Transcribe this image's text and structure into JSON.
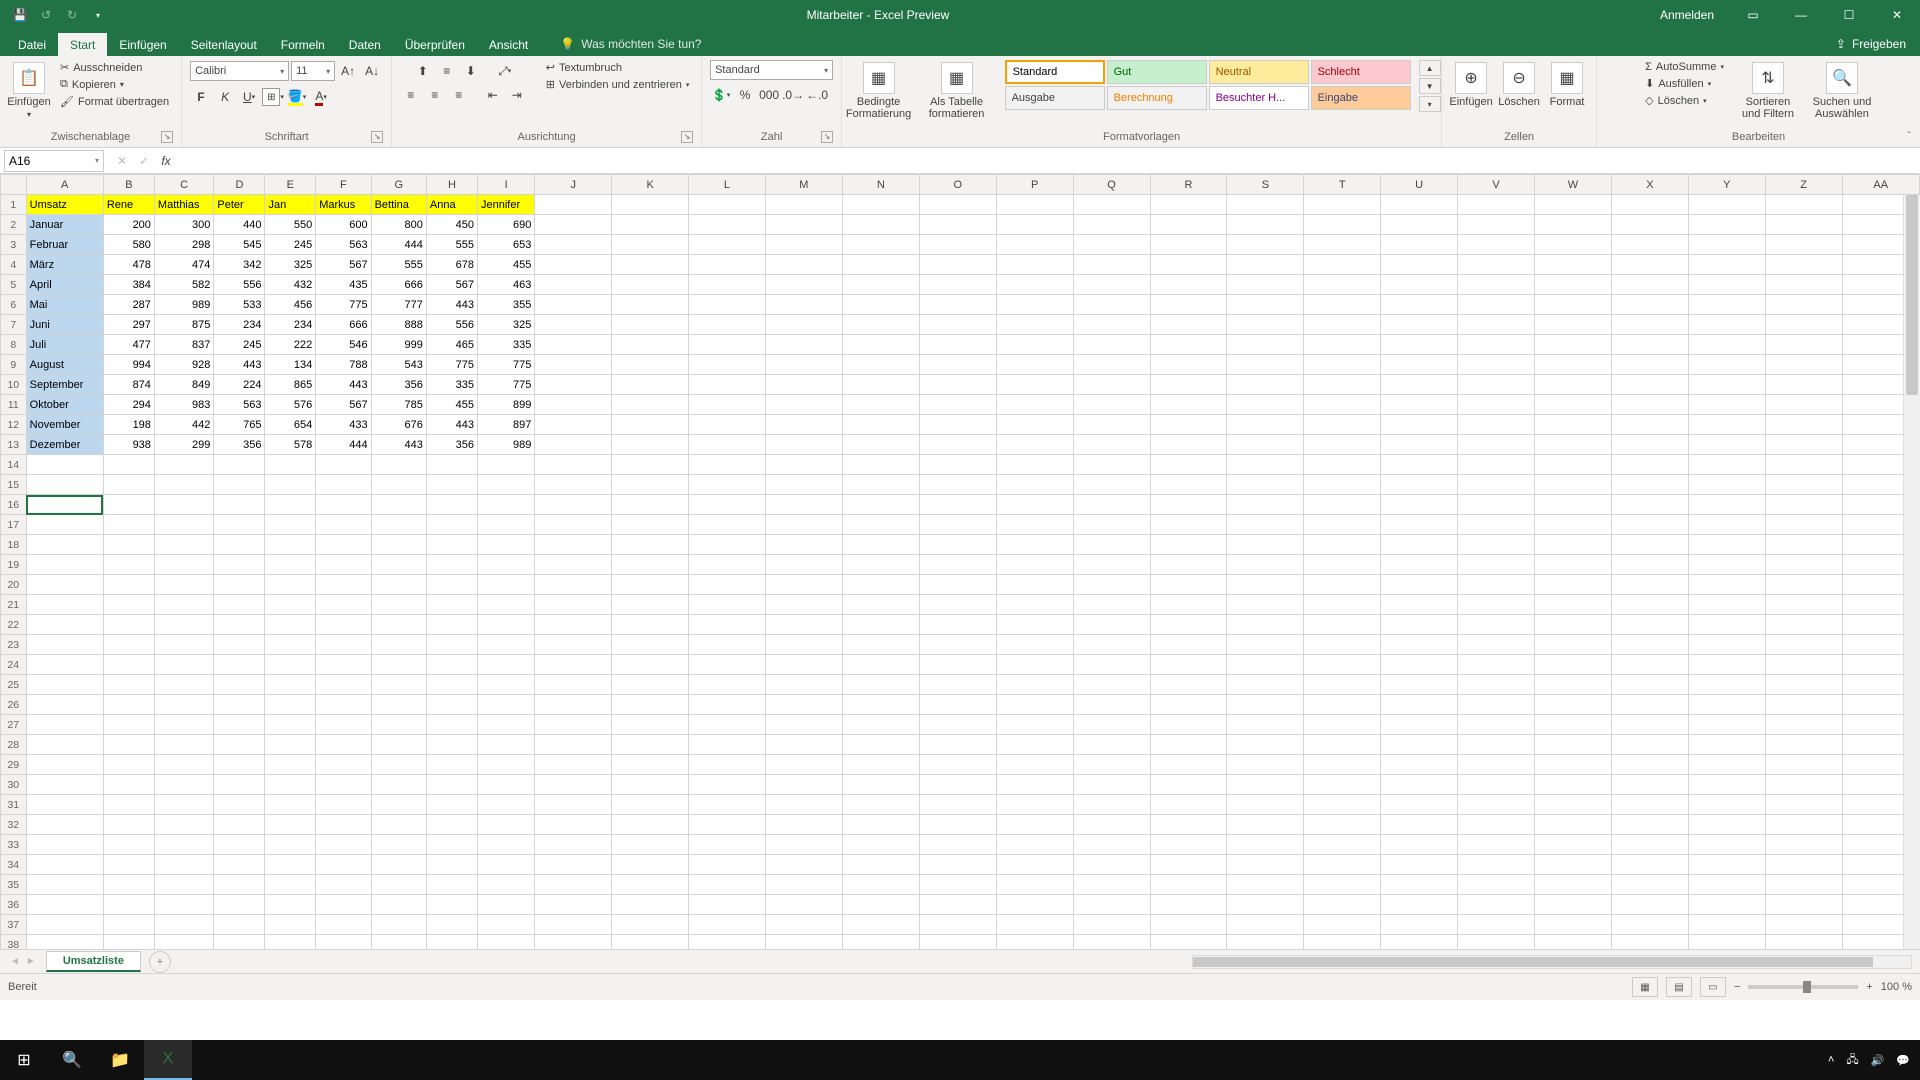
{
  "app": {
    "title": "Mitarbeiter  -  Excel Preview"
  },
  "titlebar": {
    "signin": "Anmelden"
  },
  "tabs": {
    "file": "Datei",
    "items": [
      "Start",
      "Einfügen",
      "Seitenlayout",
      "Formeln",
      "Daten",
      "Überprüfen",
      "Ansicht"
    ],
    "active": "Start",
    "tellme": "Was möchten Sie tun?",
    "share": "Freigeben"
  },
  "ribbon": {
    "clipboard": {
      "label": "Zwischenablage",
      "paste": "Einfügen",
      "cut": "Ausschneiden",
      "copy": "Kopieren",
      "painter": "Format übertragen"
    },
    "font": {
      "label": "Schriftart",
      "name": "Calibri",
      "size": "11"
    },
    "align": {
      "label": "Ausrichtung",
      "wrap": "Textumbruch",
      "merge": "Verbinden und zentrieren"
    },
    "number": {
      "label": "Zahl",
      "format": "Standard"
    },
    "styles": {
      "label": "Formatvorlagen",
      "cond": "Bedingte Formatierung",
      "table": "Als Tabelle formatieren",
      "cells": [
        {
          "t": "Standard",
          "bg": "#ffffff",
          "fg": "#000"
        },
        {
          "t": "Gut",
          "bg": "#c6efce",
          "fg": "#006100"
        },
        {
          "t": "Neutral",
          "bg": "#ffeb9c",
          "fg": "#9c5700"
        },
        {
          "t": "Schlecht",
          "bg": "#ffc7ce",
          "fg": "#9c0006"
        },
        {
          "t": "Ausgabe",
          "bg": "#f2f2f2",
          "fg": "#3f3f3f"
        },
        {
          "t": "Berechnung",
          "bg": "#f2f2f2",
          "fg": "#fa7d00"
        },
        {
          "t": "Besuchter H...",
          "bg": "#ffffff",
          "fg": "#800080"
        },
        {
          "t": "Eingabe",
          "bg": "#ffcc99",
          "fg": "#3f3f76"
        }
      ]
    },
    "cells": {
      "label": "Zellen",
      "insert": "Einfügen",
      "delete": "Löschen",
      "format": "Format"
    },
    "editing": {
      "label": "Bearbeiten",
      "autosum": "AutoSumme",
      "fill": "Ausfüllen",
      "clear": "Löschen",
      "sort": "Sortieren und Filtern",
      "find": "Suchen und Auswählen"
    }
  },
  "namebox": "A16",
  "sheet": {
    "tab": "Umsatzliste",
    "columns": [
      "A",
      "B",
      "C",
      "D",
      "E",
      "F",
      "G",
      "H",
      "I",
      "J",
      "K",
      "L",
      "M",
      "N",
      "O",
      "P",
      "Q",
      "R",
      "S",
      "T",
      "U",
      "V",
      "W",
      "X",
      "Y",
      "Z",
      "AA"
    ],
    "header_row": [
      "Umsatz",
      "Rene",
      "Matthias",
      "Peter",
      "Jan",
      "Markus",
      "Bettina",
      "Anna",
      "Jennifer"
    ],
    "rows": [
      [
        "Januar",
        200,
        300,
        440,
        550,
        600,
        800,
        450,
        690
      ],
      [
        "Februar",
        580,
        298,
        545,
        245,
        563,
        444,
        555,
        653
      ],
      [
        "März",
        478,
        474,
        342,
        325,
        567,
        555,
        678,
        455
      ],
      [
        "April",
        384,
        582,
        556,
        432,
        435,
        666,
        567,
        463
      ],
      [
        "Mai",
        287,
        989,
        533,
        456,
        775,
        777,
        443,
        355
      ],
      [
        "Juni",
        297,
        875,
        234,
        234,
        666,
        888,
        556,
        325
      ],
      [
        "Juli",
        477,
        837,
        245,
        222,
        546,
        999,
        465,
        335
      ],
      [
        "August",
        994,
        928,
        443,
        134,
        788,
        543,
        775,
        775
      ],
      [
        "September",
        874,
        849,
        224,
        865,
        443,
        356,
        335,
        775
      ],
      [
        "Oktober",
        294,
        983,
        563,
        576,
        567,
        785,
        455,
        899
      ],
      [
        "November",
        198,
        442,
        765,
        654,
        433,
        676,
        443,
        897
      ],
      [
        "Dezember",
        938,
        299,
        356,
        578,
        444,
        443,
        356,
        989
      ]
    ],
    "row_count_display": 39,
    "active_cell": "A16"
  },
  "status": {
    "ready": "Bereit",
    "zoom": "100 %"
  }
}
